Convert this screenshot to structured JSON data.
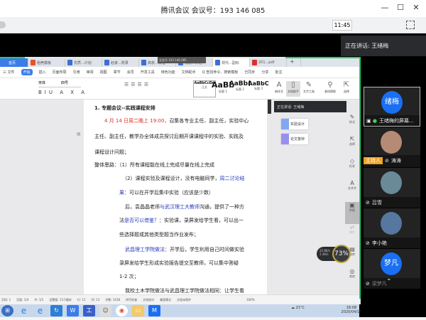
{
  "window": {
    "title": "腾讯会议 会议号：193 146 085",
    "minimize": "—",
    "maximize": "☐",
    "close": "✕"
  },
  "toolbar": {
    "timer": "11:45",
    "fullscreen_icon": "fullscreen-icon"
  },
  "speaking": "正在讲话: 王绪梅",
  "wps": {
    "tabs": [
      "首页",
      "稻壳模板",
      "优质...计划",
      "赵家...附录",
      "高校...课程",
      "全会号 193 146 085",
      "优质...计划",
      "现代...副标",
      "201...pdf"
    ],
    "menu": [
      "三 文件",
      "开始",
      "插入",
      "页面布局",
      "引用",
      "审阅",
      "视图",
      "章节",
      "会员",
      "开发工具",
      "特色功能",
      "文档助手",
      "Q 查找命令、搜索模板",
      "已同步",
      "分享",
      "批注"
    ],
    "font": "宋体",
    "size": "四号",
    "styles": [
      {
        "sample": "AaBbCcDd",
        "name": "正文"
      },
      {
        "sample": "AaBb",
        "name": "标题 1"
      },
      {
        "sample": "AaBb(",
        "name": "标题 2"
      },
      {
        "sample": "AaBbC",
        "name": "标题 3"
      }
    ],
    "ribbon_buttons": [
      "新样式",
      "文档助手",
      "文字工具",
      "查找替换",
      "选择"
    ]
  },
  "doc": {
    "heading": "1. 专题会议--实践课程安排",
    "p1_red": "4 月 14 日周二晚上 19:00，",
    "p1": "召集各专业主任、副主任，实验中心",
    "p1b": "主任、副主任，教学办全体成员探讨后期开课课程中的实验、实践及",
    "p1c": "课程设计问题；",
    "p2": "整体思路：（1）所有课程能在线上完成尽量在线上完成",
    "p3": "（2）课程实验及课程设计，没有电脑同学，",
    "p3_blue": "周二讨论结",
    "p3b_blue": "果：",
    "p3b": "可以在开学后集中实验（应该是少数）",
    "p4a": "后，袁晶晶老师",
    "p4_blue": "与武汉理工大教师",
    "p4b": "沟通，提供了一种方",
    "p5a": "法",
    "p5_blue": "是否可以借鉴？",
    "p5b": "：实验课，录屏发给学生看，可以出一",
    "p6": "些选择题或其他类型题当作业发布；",
    "p7_blue": "武昌理工学院做法",
    "p7": "：开学后，学生利用自己时间做实验",
    "p8": "录屏发给学生形成实验报告提交至教师，可以集中答疑",
    "p9": "1-2 次；",
    "p10_blue": "我校土木学院做法与武昌理工学院做法相同：让学生看"
  },
  "side": {
    "tooltip": "正在讲话: 王绪梅",
    "cards": [
      "实验设计",
      "论文答辩"
    ],
    "icons": [
      {
        "label": "样式",
        "icon": "✎"
      },
      {
        "label": "选择",
        "icon": "⇱"
      },
      {
        "label": "形状",
        "icon": "◇"
      },
      {
        "label": "艺术字",
        "icon": "A"
      },
      {
        "label": "附图",
        "icon": "▣"
      },
      {
        "label": "属性",
        "icon": "⇄"
      },
      {
        "label": "图库",
        "icon": "▤"
      },
      {
        "label": "其他",
        "icon": "◎"
      },
      {
        "label": "设置",
        "icon": "…"
      }
    ],
    "speed_up": "22.8K/s",
    "speed_down": "1.3K/s",
    "gauge": "73%"
  },
  "statusbar": [
    "页码: 1",
    "页面: 1/4",
    "节: 1/1",
    "设置值: 13.5厘米",
    "行: 11",
    "列: 13",
    "字数: 1418",
    "拼写检查",
    "文档校对",
    "兼容模式",
    "文档未保护",
    "100%"
  ],
  "taskbar": {
    "apps": [
      "start",
      "ie",
      "ie",
      "qq",
      "wps-writer",
      "wps",
      "photo",
      "chrome",
      "folder",
      "meeting"
    ],
    "weather": "21°C",
    "time": "18:08",
    "date": "2020/04/17"
  },
  "participants": [
    {
      "name": "王绪梅的屏幕...",
      "avatar": "绪梅",
      "color": "#1a6ff2",
      "mic": "on",
      "screen": true
    },
    {
      "name": "涛涛",
      "avatar": "",
      "host": "主持人",
      "mic": "muted",
      "color": "#b68a74"
    },
    {
      "name": "吕雪",
      "avatar": "",
      "mic": "muted",
      "color": "#6a8a98"
    },
    {
      "name": "李小艳",
      "avatar": "",
      "mic": "muted",
      "color": "#5577a0"
    },
    {
      "name": "梁梦凡",
      "avatar": "梦凡",
      "mic": "muted",
      "color": "#1a6ff2"
    }
  ]
}
